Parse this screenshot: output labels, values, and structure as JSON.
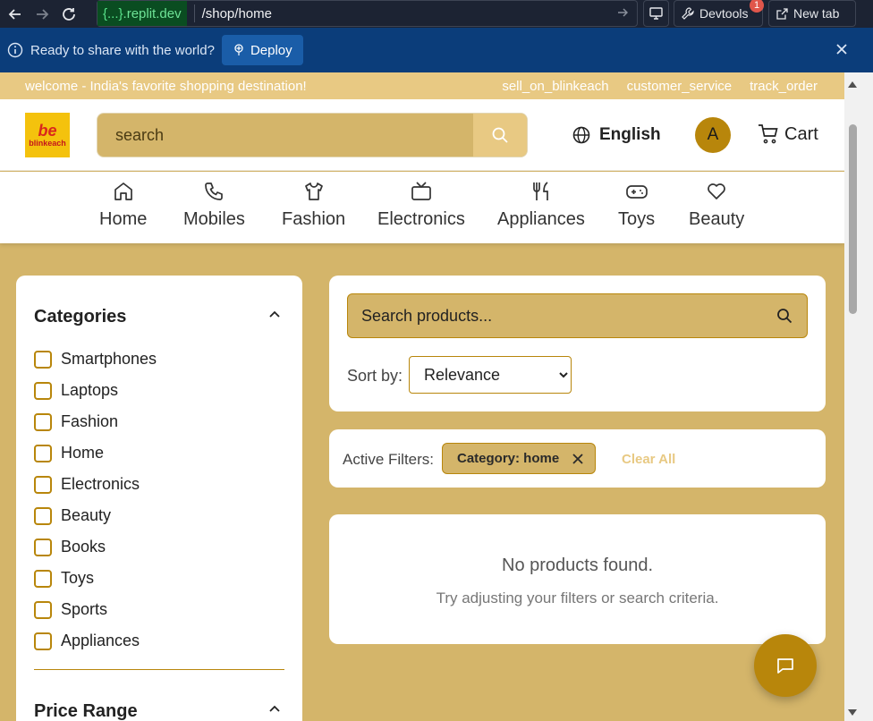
{
  "browser": {
    "url_host_prefix": "{...}",
    "url_host_suffix": ".replit.dev",
    "url_path": "/shop/home",
    "devtools_label": "Devtools",
    "devtools_badge": "1",
    "new_tab_label": "New tab"
  },
  "deploy_bar": {
    "message": "Ready to share with the world?",
    "button_label": "Deploy"
  },
  "welcome_bar": {
    "text": "welcome - India's favorite shopping destination!",
    "links": [
      "sell_on_blinkeach",
      "customer_service",
      "track_order"
    ]
  },
  "header": {
    "logo_text": "blinkeach",
    "search_placeholder": "search",
    "language": "English",
    "avatar_initial": "A",
    "cart_label": "Cart"
  },
  "categories_nav": [
    {
      "label": "Home",
      "icon": "home-icon"
    },
    {
      "label": "Mobiles",
      "icon": "phone-icon"
    },
    {
      "label": "Fashion",
      "icon": "shirt-icon"
    },
    {
      "label": "Electronics",
      "icon": "tv-icon"
    },
    {
      "label": "Appliances",
      "icon": "utensils-icon"
    },
    {
      "label": "Toys",
      "icon": "gamepad-icon"
    },
    {
      "label": "Beauty",
      "icon": "heart-icon"
    }
  ],
  "sidebar": {
    "categories_title": "Categories",
    "categories": [
      "Smartphones",
      "Laptops",
      "Fashion",
      "Home",
      "Electronics",
      "Beauty",
      "Books",
      "Toys",
      "Sports",
      "Appliances"
    ],
    "price_title": "Price Range"
  },
  "products": {
    "search_placeholder": "Search products...",
    "sort_label": "Sort by:",
    "sort_selected": "Relevance",
    "active_filters_label": "Active Filters:",
    "active_filter_chip": "Category: home",
    "clear_all_label": "Clear All",
    "empty_title": "No products found.",
    "empty_subtitle": "Try adjusting your filters or search criteria."
  },
  "colors": {
    "gold": "#d4b56a",
    "light_gold": "#e8c983",
    "dark_gold": "#b8860b",
    "deploy_blue": "#0b3d7a"
  }
}
